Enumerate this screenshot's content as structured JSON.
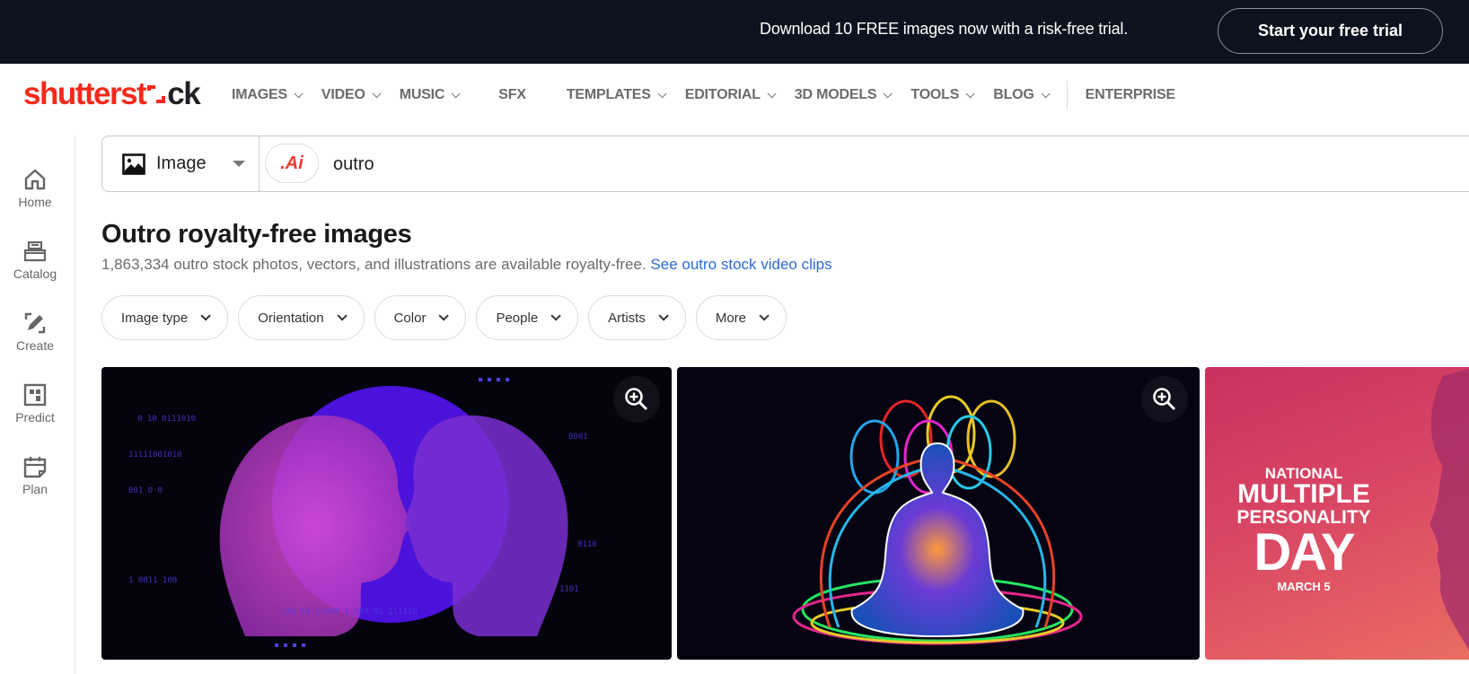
{
  "promo": {
    "text": "Download 10 FREE images now with a risk-free trial.",
    "cta_label": "Start your free trial"
  },
  "brand": {
    "logo_part1": "shutterst",
    "logo_part2": "ck",
    "logo_accent": "#f4291b"
  },
  "nav": {
    "items": [
      {
        "label": "IMAGES",
        "has_menu": true
      },
      {
        "label": "VIDEO",
        "has_menu": true
      },
      {
        "label": "MUSIC",
        "has_menu": true
      },
      {
        "label": "SFX",
        "has_menu": false
      },
      {
        "label": "TEMPLATES",
        "has_menu": true
      },
      {
        "label": "EDITORIAL",
        "has_menu": true
      },
      {
        "label": "3D MODELS",
        "has_menu": true
      },
      {
        "label": "TOOLS",
        "has_menu": true
      },
      {
        "label": "BLOG",
        "has_menu": true
      },
      {
        "label": "ENTERPRISE",
        "has_menu": false
      }
    ]
  },
  "sidebar": {
    "items": [
      {
        "label": "Home",
        "icon": "home-icon"
      },
      {
        "label": "Catalog",
        "icon": "catalog-icon"
      },
      {
        "label": "Create",
        "icon": "create-icon"
      },
      {
        "label": "Predict",
        "icon": "predict-icon"
      },
      {
        "label": "Plan",
        "icon": "plan-icon"
      }
    ]
  },
  "search": {
    "type_label": "Image",
    "ai_badge": ".Ai",
    "query": "outro"
  },
  "results": {
    "title": "Outro royalty-free images",
    "summary": "1,863,334 outro stock photos, vectors, and illustrations are available royalty-free.",
    "video_link": "See outro stock video clips"
  },
  "filters": [
    {
      "label": "Image type"
    },
    {
      "label": "Orientation"
    },
    {
      "label": "Color"
    },
    {
      "label": "People"
    },
    {
      "label": "Artists"
    },
    {
      "label": "More"
    }
  ],
  "images": [
    {
      "description": "Two digital particle heads facing each other over a purple circle with binary code"
    },
    {
      "description": "Meditating figure with colorful neon aura lines"
    },
    {
      "description": "National Multiple Personality Day poster",
      "text_lines": [
        "NATIONAL",
        "MULTIPLE",
        "PERSONALITY",
        "DAY",
        "MARCH 5"
      ]
    }
  ]
}
